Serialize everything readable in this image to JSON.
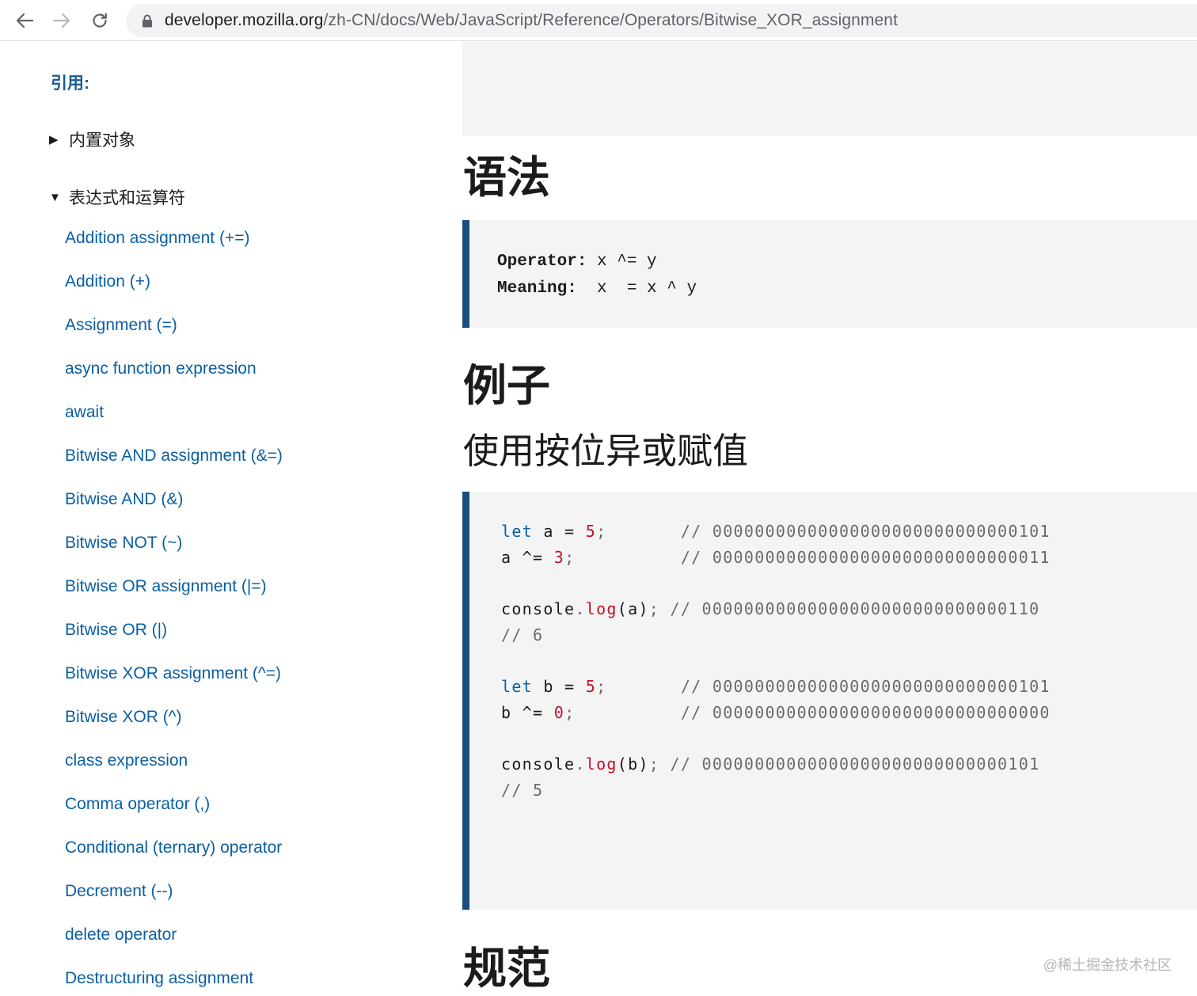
{
  "browser": {
    "url_host": "developer.mozilla.org",
    "url_path": "/zh-CN/docs/Web/JavaScript/Reference/Operators/Bitwise_XOR_assignment"
  },
  "sidebar": {
    "title": "引用:",
    "groups": [
      {
        "label": "内置对象",
        "expanded": false,
        "marker": "▶"
      },
      {
        "label": "表达式和运算符",
        "expanded": true,
        "marker": "▼"
      }
    ],
    "links": [
      "Addition assignment (+=)",
      "Addition (+)",
      "Assignment (=)",
      "async function expression",
      "await",
      "Bitwise AND assignment (&=)",
      "Bitwise AND (&)",
      "Bitwise NOT (~)",
      "Bitwise OR assignment (|=)",
      "Bitwise OR (|)",
      "Bitwise XOR assignment (^=)",
      "Bitwise XOR (^)",
      "class expression",
      "Comma operator (,)",
      "Conditional (ternary) operator",
      "Decrement (--)",
      "delete operator",
      "Destructuring assignment"
    ]
  },
  "main": {
    "syntax_heading": "语法",
    "syntax_code": {
      "operator_label": "Operator:",
      "operator_value": " x ^= y",
      "meaning_label": "Meaning:",
      "meaning_value": "  x  = x ^ y"
    },
    "examples_heading": "例子",
    "example_subheading": "使用按位异或赋值",
    "spec_heading": "规范",
    "example_code": {
      "line1": {
        "kw": "let",
        "code": " a = ",
        "num": "5",
        "end": ";",
        "pad": "       ",
        "comment": "// 00000000000000000000000000000101"
      },
      "line2": {
        "code": "a ^= ",
        "num": "3",
        "end": ";",
        "pad": "          ",
        "comment": "// 00000000000000000000000000000011"
      },
      "line3": {
        "obj": "console",
        "dot": ".",
        "fn": "log",
        "args": "(a)",
        "end": ";",
        "pad": " ",
        "comment": "// 00000000000000000000000000000110"
      },
      "line4": {
        "comment": "// 6"
      },
      "line5": {
        "kw": "let",
        "code": " b = ",
        "num": "5",
        "end": ";",
        "pad": "       ",
        "comment": "// 00000000000000000000000000000101"
      },
      "line6": {
        "code": "b ^= ",
        "num": "0",
        "end": ";",
        "pad": "          ",
        "comment": "// 00000000000000000000000000000000"
      },
      "line7": {
        "obj": "console",
        "dot": ".",
        "fn": "log",
        "args": "(b)",
        "end": ";",
        "pad": " ",
        "comment": "// 00000000000000000000000000000101"
      },
      "line8": {
        "comment": "// 5"
      }
    }
  },
  "watermark": "@稀土掘金技术社区"
}
